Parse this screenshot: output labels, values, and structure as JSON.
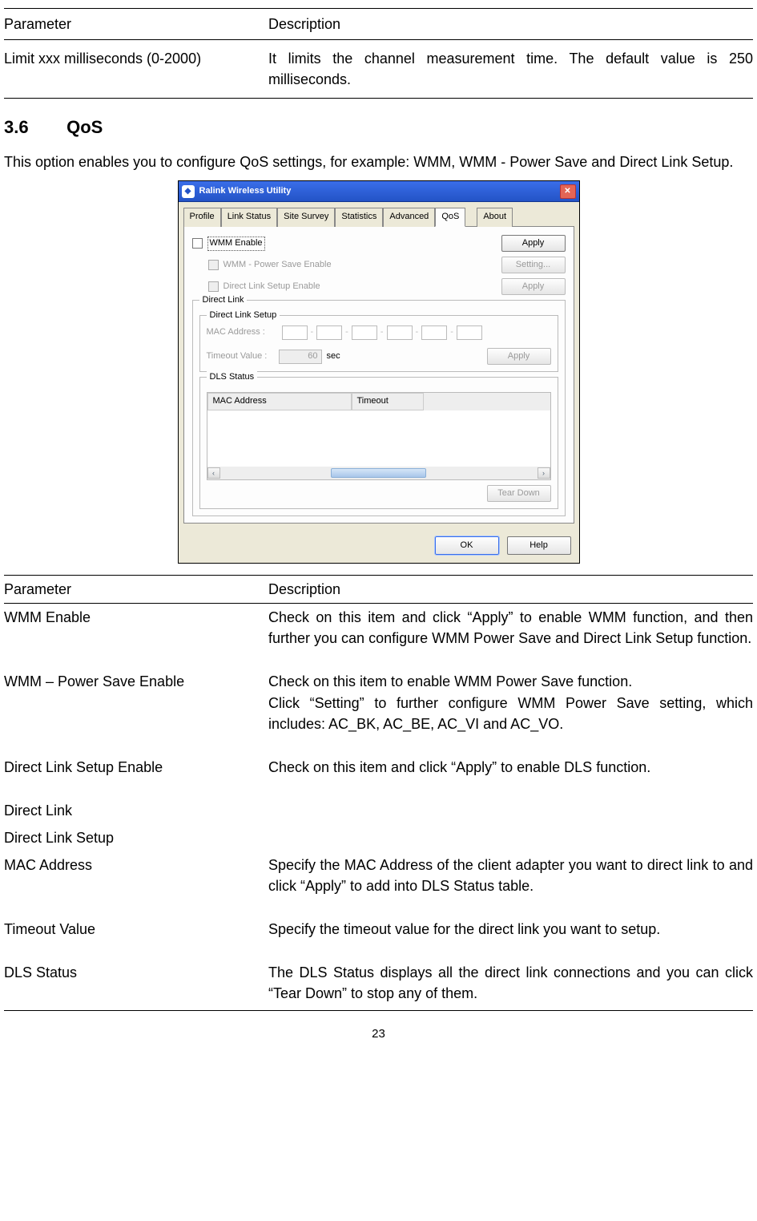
{
  "top_table": {
    "h1": "Parameter",
    "h2": "Description",
    "p": "Limit xxx milliseconds (0-2000)",
    "d": "It limits the channel measurement time. The default value is 250 milliseconds."
  },
  "section": {
    "num": "3.6",
    "title": "QoS"
  },
  "intro": "This option enables you to configure QoS settings, for example: WMM, WMM - Power Save and Direct Link Setup.",
  "win": {
    "title": "Ralink Wireless Utility",
    "tabs": {
      "t0": "Profile",
      "t1": "Link Status",
      "t2": "Site Survey",
      "t3": "Statistics",
      "t4": "Advanced",
      "t5": "QoS",
      "t6": "About"
    },
    "chk": {
      "wmm": "WMM Enable",
      "ps": "WMM - Power Save Enable",
      "dls": "Direct Link Setup Enable"
    },
    "btn": {
      "apply": "Apply",
      "setting": "Setting...",
      "teardown": "Tear Down",
      "ok": "OK",
      "help": "Help"
    },
    "grp": {
      "dl": "Direct Link",
      "setup": "Direct Link Setup",
      "dlsstat": "DLS Status"
    },
    "lbl": {
      "mac": "MAC Address :",
      "tv": "Timeout Value :",
      "sec": "sec",
      "tv_val": "60"
    },
    "dlshdr": {
      "mac": "MAC Address",
      "timeout": "Timeout"
    }
  },
  "pt": {
    "h1": "Parameter",
    "h2": "Description",
    "r1p": "WMM Enable",
    "r1d": "Check on this item and click “Apply” to enable WMM function, and then further you can configure WMM Power Save and Direct Link Setup function.",
    "r2p": "WMM – Power Save Enable",
    "r2d1": "Check on this item to enable WMM Power Save function.",
    "r2d2": "Click “Setting” to further configure WMM Power Save setting, which includes: AC_BK, AC_BE, AC_VI and AC_VO.",
    "r3p": "Direct Link Setup Enable",
    "r3d": "Check on this item and click “Apply” to enable DLS function.",
    "r4p": "Direct Link",
    "r5p": "Direct Link Setup",
    "r6p": "MAC Address",
    "r6d": "Specify the MAC Address of the client adapter you want to direct link to and click “Apply” to add into DLS Status table.",
    "r7p": "Timeout Value",
    "r7d": "Specify the timeout value for the direct link you want to setup.",
    "r8p": "DLS Status",
    "r8d": "The DLS Status displays all the direct link connections and you can click “Tear Down” to stop any of them."
  },
  "page": "23"
}
